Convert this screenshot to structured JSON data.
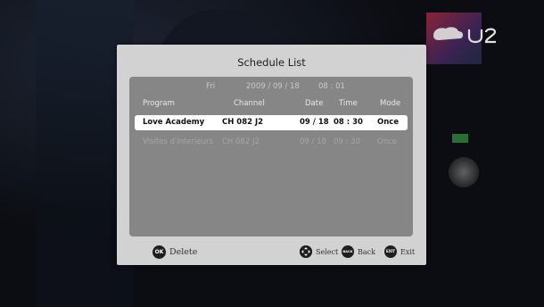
{
  "brand": {
    "logo_text": "U2"
  },
  "dialog": {
    "title": "Schedule List",
    "current": {
      "day": "Fri",
      "date": "2009 / 09 / 18",
      "time": "08 : 01"
    },
    "columns": {
      "program": "Program",
      "channel": "Channel",
      "date": "Date",
      "time": "Time",
      "mode": "Mode"
    },
    "items": [
      {
        "program": "Love Academy",
        "channel": "CH 082 J2",
        "date": "09 / 18",
        "time": "08 : 30",
        "mode": "Once"
      },
      {
        "program": "Visites d'interieurs",
        "channel": "CH 082 J2",
        "date": "09 / 18",
        "time": "09 : 30",
        "mode": "Once"
      }
    ],
    "footer": {
      "ok_key": "OK",
      "delete_label": "Delete",
      "select_label": "Select",
      "back_key": "BACK",
      "back_label": "Back",
      "exit_key": "EXIT",
      "exit_label": "Exit"
    }
  }
}
